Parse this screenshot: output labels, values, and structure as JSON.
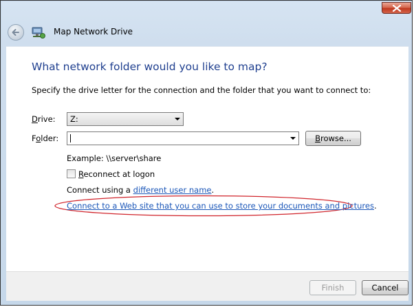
{
  "window": {
    "title": "Map Network Drive"
  },
  "icons": {
    "close": "close-icon",
    "back": "back-arrow-icon",
    "app": "network-drive-icon"
  },
  "main": {
    "heading": "What network folder would you like to map?",
    "instruction": "Specify the drive letter for the connection and the folder that you want to connect to:",
    "drive_label_mnemonic": "D",
    "drive_label_rest": "rive:",
    "drive_value": "Z:",
    "folder_label_pre": "F",
    "folder_label_mnemonic": "o",
    "folder_label_rest": "lder:",
    "folder_value": "",
    "browse_mnemonic": "B",
    "browse_rest": "rowse...",
    "example": "Example: \\\\server\\share",
    "reconnect_mnemonic": "R",
    "reconnect_rest": "econnect at logon",
    "reconnect_checked": false,
    "connect_using_prefix": "Connect using a ",
    "different_user_link": "different user name",
    "connect_using_suffix": ".",
    "web_site_link": "Connect to a Web site that you can use to store your documents and pictures",
    "web_site_suffix": "."
  },
  "footer": {
    "finish_label": "Finish",
    "cancel_label": "Cancel"
  },
  "colors": {
    "heading": "#1f3f8f",
    "link": "#1a56b8",
    "highlight_ellipse": "#d0232a"
  }
}
